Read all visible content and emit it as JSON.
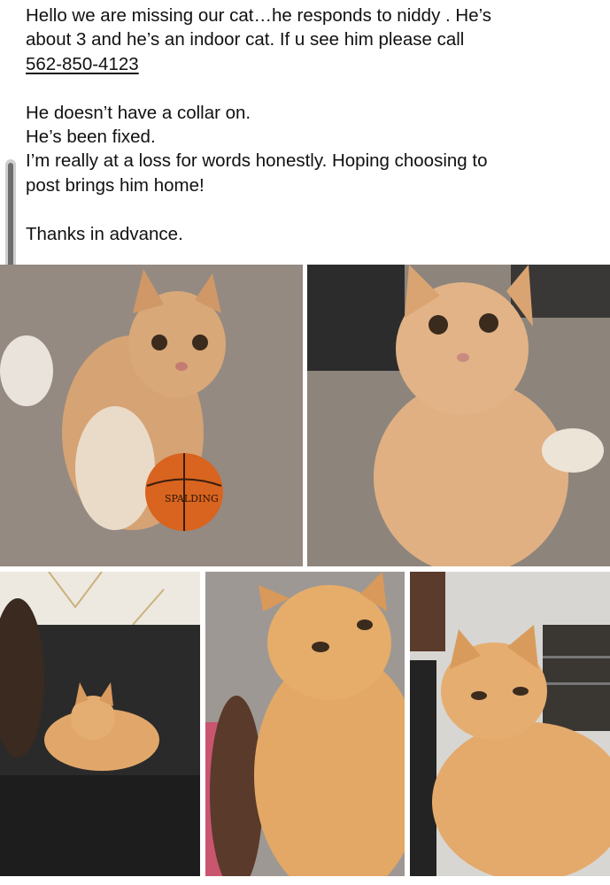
{
  "post": {
    "line1": "Hello we are missing our cat…he responds to niddy . He’s",
    "line2": "about 3 and he’s an indoor cat. If u see him please call",
    "phone": "562-850-4123",
    "line4": "He doesn’t have a collar on.",
    "line5": "He’s been fixed.",
    "line6": "I’m really at a loss for words honestly. Hoping choosing to",
    "line7": "post brings him home!",
    "line8": "Thanks in advance."
  },
  "photos": {
    "ball_brand": "SPALDING"
  },
  "colors": {
    "cat_fur": "#d9a06a",
    "carpet": "#9a9088",
    "couch": "#2a2a2a",
    "ball": "#d8641f"
  }
}
